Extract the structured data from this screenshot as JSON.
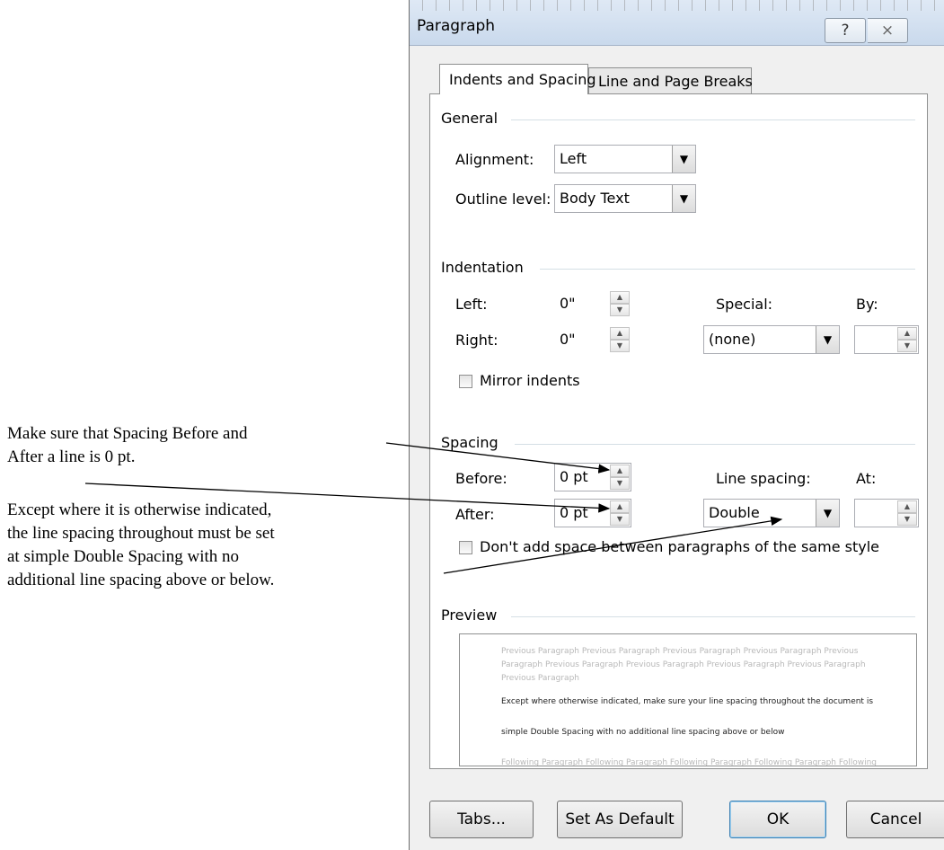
{
  "annotations": {
    "note1_line1": "Make sure that Spacing Before and",
    "note1_line2": "After a line is 0 pt.",
    "note2_line1": "Except where it is otherwise indicated,",
    "note2_line2": "the line spacing throughout must be set",
    "note2_line3": "at simple Double Spacing with no",
    "note2_line4": "additional line spacing above or below."
  },
  "dialog": {
    "title": "Paragraph",
    "help_icon": "question-mark-icon",
    "close_icon": "close-icon",
    "help_glyph": "?",
    "close_glyph": "⨯"
  },
  "tabs": [
    {
      "label": "Indents and Spacing",
      "active": true
    },
    {
      "label": "Line and Page Breaks",
      "active": false
    }
  ],
  "general": {
    "heading": "General",
    "alignment_label": "Alignment:",
    "alignment_value": "Left",
    "outline_label": "Outline level:",
    "outline_value": "Body Text"
  },
  "indentation": {
    "heading": "Indentation",
    "left_label": "Left:",
    "left_value": "0\"",
    "right_label": "Right:",
    "right_value": "0\"",
    "special_label": "Special:",
    "special_value": "(none)",
    "by_label": "By:",
    "by_value": "",
    "mirror_label": "Mirror indents",
    "mirror_checked": false
  },
  "spacing": {
    "heading": "Spacing",
    "before_label": "Before:",
    "before_value": "0 pt",
    "after_label": "After:",
    "after_value": "0 pt",
    "line_spacing_label": "Line spacing:",
    "line_spacing_value": "Double",
    "at_label": "At:",
    "at_value": "",
    "dont_add_label": "Don't add space between paragraphs of the same style",
    "dont_add_checked": false
  },
  "preview": {
    "heading": "Preview",
    "previous_line1": "Previous Paragraph Previous Paragraph Previous Paragraph Previous Paragraph Previous",
    "previous_line2": "Paragraph Previous Paragraph Previous Paragraph Previous Paragraph Previous Paragraph",
    "previous_line3": "Previous Paragraph",
    "current_line1": "Except where otherwise indicated, make sure your line spacing throughout the document is",
    "current_line2": "simple Double Spacing with no additional line spacing above or below",
    "following_line1": "Following Paragraph Following Paragraph Following Paragraph Following Paragraph Following"
  },
  "buttons": {
    "tabs": "Tabs...",
    "set_default": "Set As Default",
    "ok": "OK",
    "cancel": "Cancel"
  },
  "icons": {
    "dropdown": "chevron-down-icon",
    "spin_up": "spin-up-icon",
    "spin_down": "spin-down-icon"
  },
  "colors": {
    "titlebar": "#c9d9ec",
    "dialog_bg": "#f0f0f0",
    "ok_border": "#3c7fb1"
  }
}
